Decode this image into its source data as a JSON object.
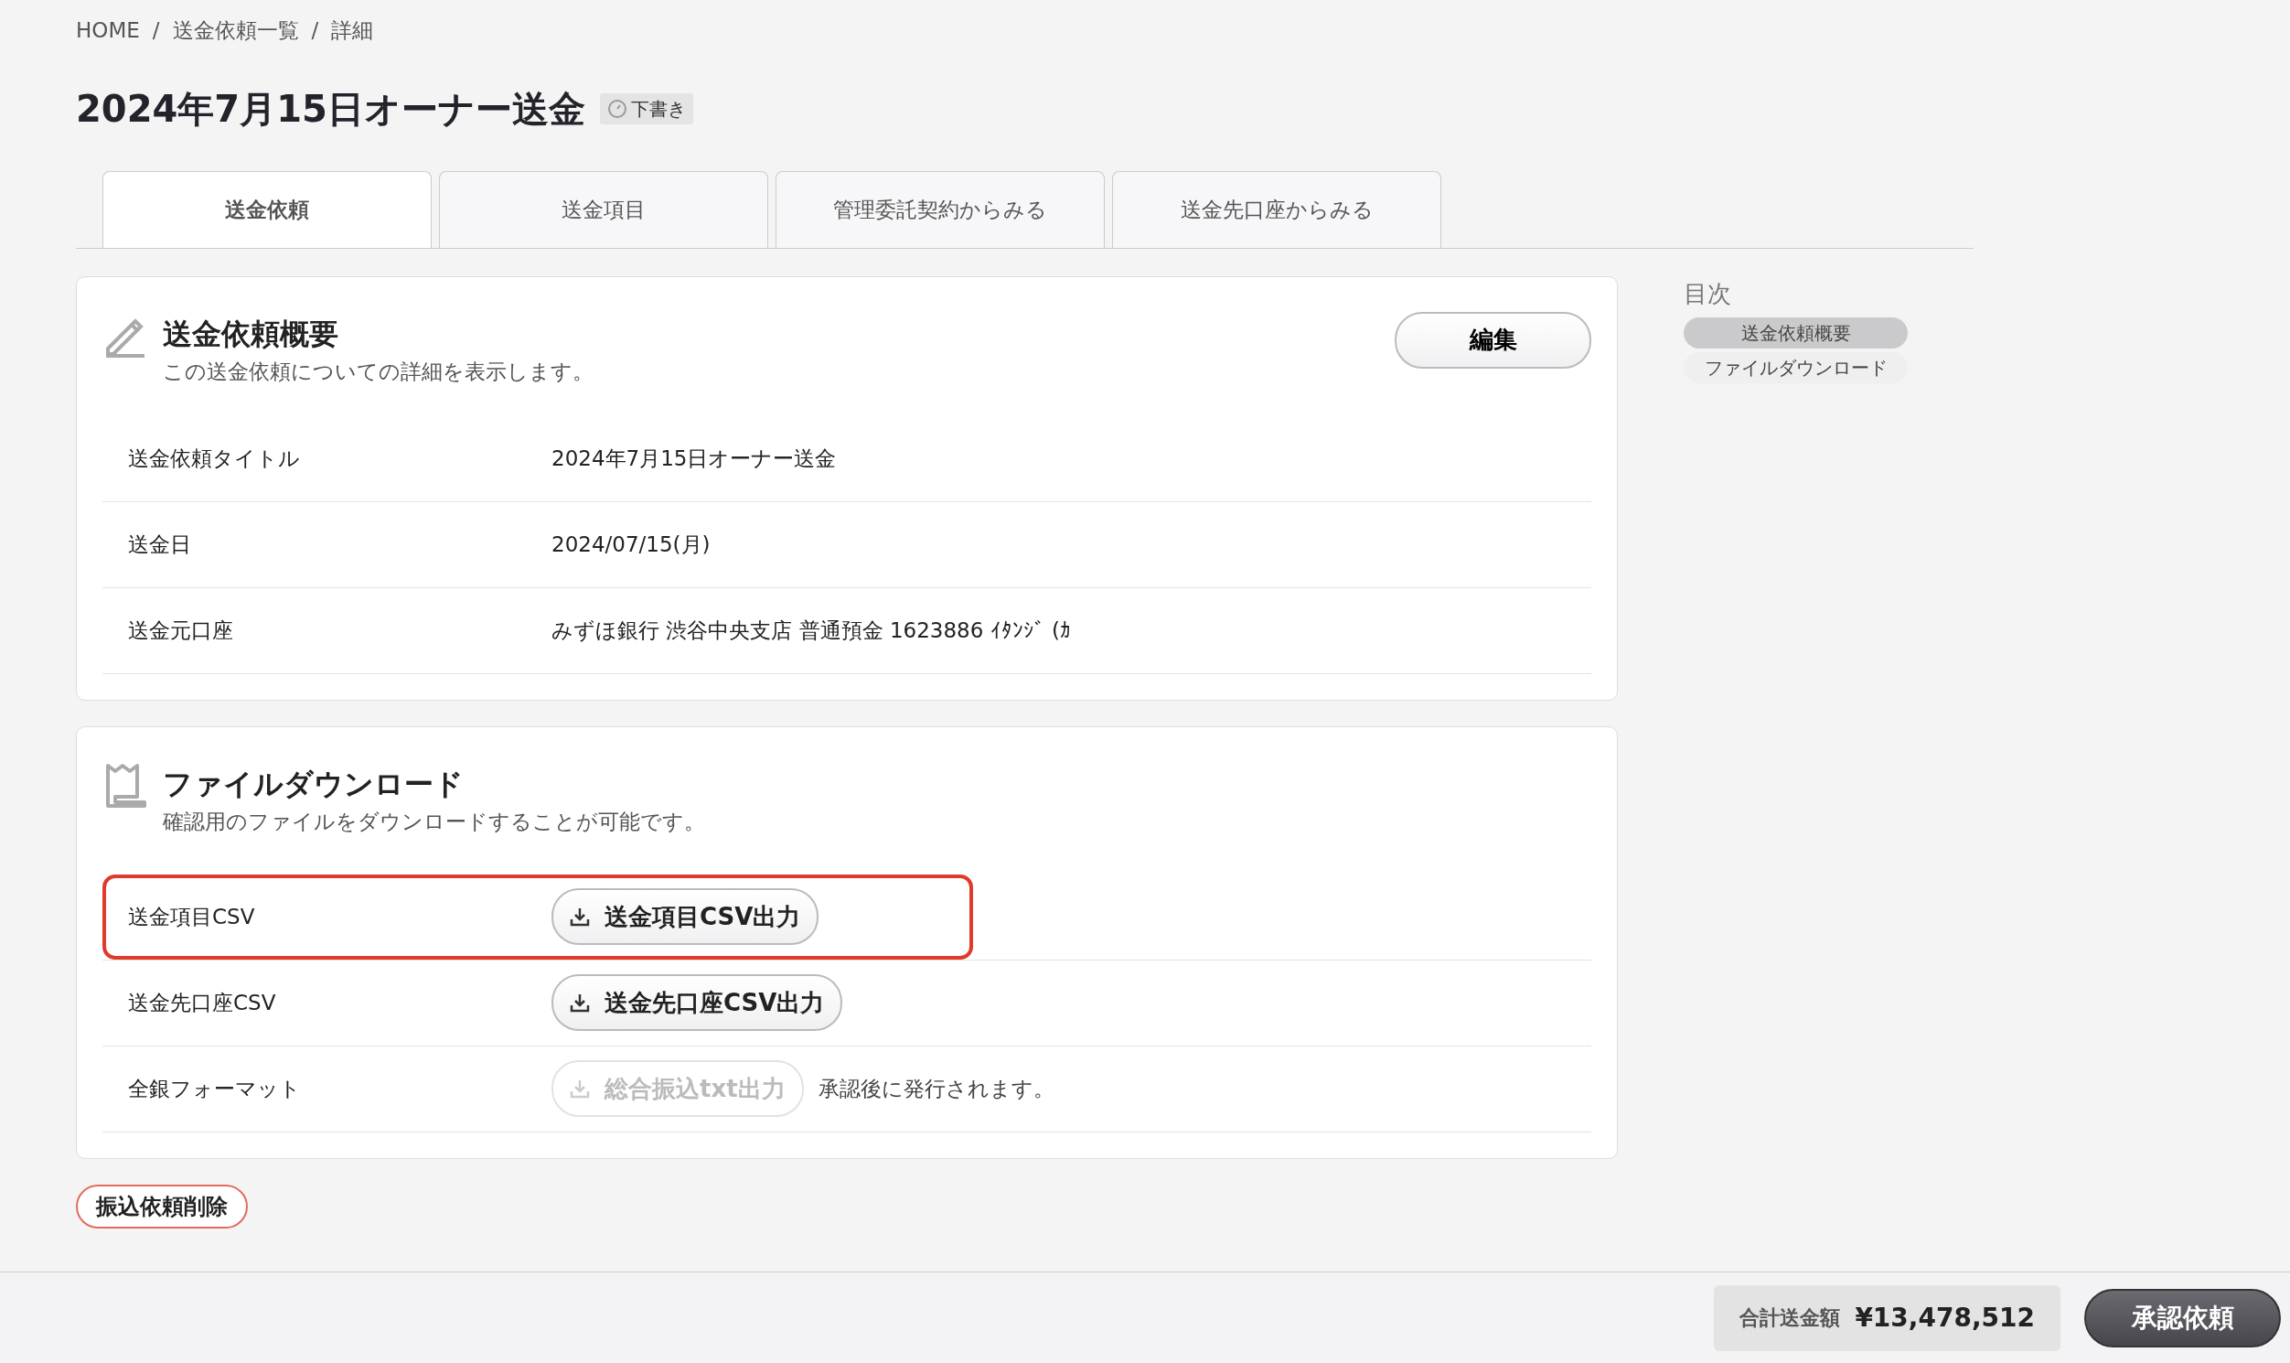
{
  "breadcrumb": [
    {
      "kind": "link",
      "text": "HOME"
    },
    {
      "kind": "separator",
      "text": "/"
    },
    {
      "kind": "link",
      "text": "送金依頼一覧"
    },
    {
      "kind": "separator",
      "text": "/"
    },
    {
      "kind": "current",
      "text": "詳細"
    }
  ],
  "title": "2024年7月15日オーナー送金",
  "status_badge": "下書き",
  "tabs": [
    {
      "label": "送金依頼",
      "selected": true
    },
    {
      "label": "送金項目",
      "selected": false
    },
    {
      "label": "管理委託契約からみる",
      "selected": false
    },
    {
      "label": "送金先口座からみる",
      "selected": false
    }
  ],
  "summary_card": {
    "title": "送金依頼概要",
    "description": "この送金依頼についての詳細を表示します。",
    "edit_button": "編集",
    "rows": [
      {
        "label": "送金依頼タイトル",
        "value": "2024年7月15日オーナー送金"
      },
      {
        "label": "送金日",
        "value": "2024/07/15(月)"
      },
      {
        "label": "送金元口座",
        "value": "みずほ銀行 渋谷中央支店 普通預金 1623886 ｲﾀﾝｼﾞ (ｶ"
      }
    ]
  },
  "download_card": {
    "title": "ファイルダウンロード",
    "description": "確認用のファイルをダウンロードすることが可能です。",
    "rows": [
      {
        "label": "送金項目CSV",
        "button": "送金項目CSV出力",
        "disabled": false,
        "highlighted": true
      },
      {
        "label": "送金先口座CSV",
        "button": "送金先口座CSV出力",
        "disabled": false,
        "highlighted": false
      },
      {
        "label": "全銀フォーマット",
        "button": "総合振込txt出力",
        "disabled": true,
        "highlighted": false,
        "note": "承認後に発行されます。"
      }
    ]
  },
  "delete_button": "振込依頼削除",
  "toc": {
    "heading": "目次",
    "items": [
      {
        "label": "送金依頼概要",
        "selected": true
      },
      {
        "label": "ファイルダウンロード",
        "selected": false
      }
    ]
  },
  "footer": {
    "total_label": "合計送金額",
    "total_value": "¥13,478,512",
    "approve_button": "承認依頼"
  }
}
